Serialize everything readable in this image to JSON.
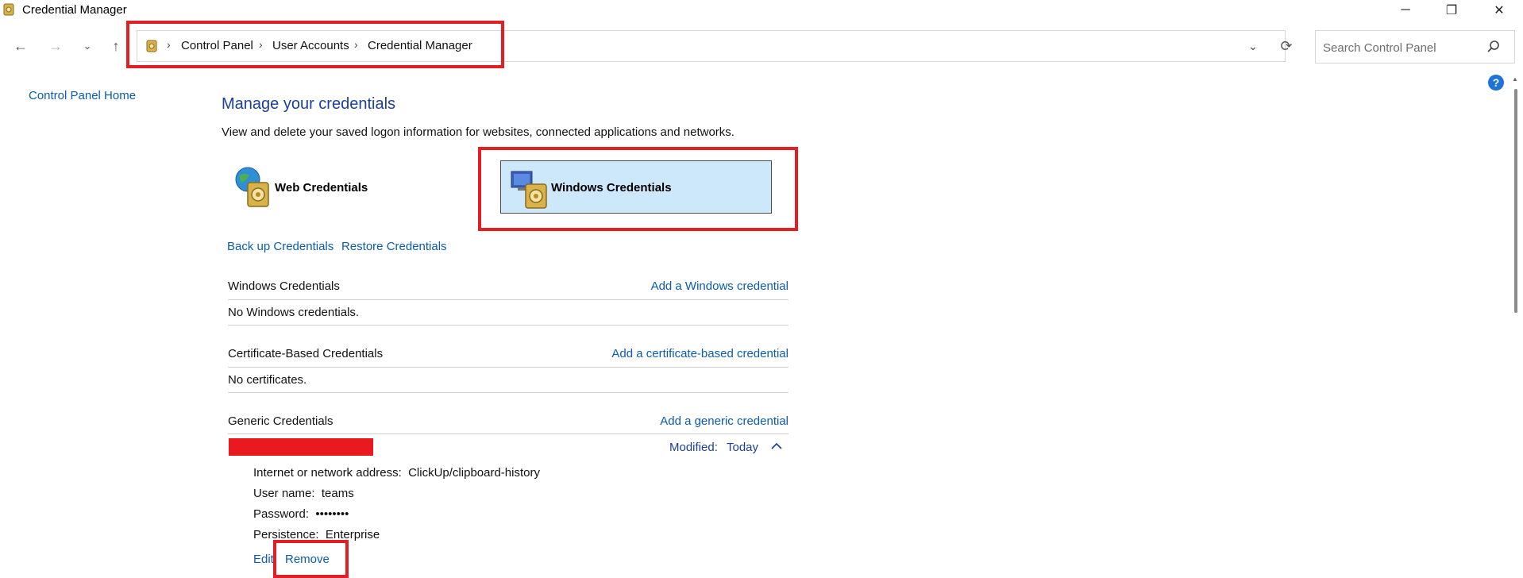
{
  "window": {
    "title": "Credential Manager",
    "minimize_glyph": "─",
    "maximize_glyph": "❐",
    "close_glyph": "✕"
  },
  "nav": {
    "back_glyph": "←",
    "forward_glyph": "→",
    "recent_glyph": "⌄",
    "up_glyph": "↑",
    "refresh_glyph": "⟳",
    "dropdown_glyph": "⌄"
  },
  "breadcrumb": {
    "separator": "›",
    "items": [
      "Control Panel",
      "User Accounts",
      "Credential Manager"
    ]
  },
  "search": {
    "placeholder": "Search Control Panel"
  },
  "help": {
    "glyph": "?"
  },
  "left_nav": {
    "home": "Control Panel Home"
  },
  "main": {
    "title": "Manage your credentials",
    "description": "View and delete your saved logon information for websites, connected applications and networks.",
    "tiles": {
      "web": "Web Credentials",
      "windows": "Windows Credentials"
    },
    "actions": {
      "backup": "Back up Credentials",
      "restore": "Restore Credentials"
    },
    "sections": [
      {
        "title": "Windows Credentials",
        "link": "Add a Windows credential",
        "empty": "No Windows credentials."
      },
      {
        "title": "Certificate-Based Credentials",
        "link": "Add a certificate-based credential",
        "empty": "No certificates."
      },
      {
        "title": "Generic Credentials",
        "link": "Add a generic credential"
      }
    ],
    "credential": {
      "modified_label": "Modified:",
      "modified_value": "Today",
      "details": {
        "address": "Internet or network address:  ClickUp/clipboard-history",
        "username": "User name:  teams",
        "password": "Password:  ••••••••",
        "persistence": "Persistence:  Enterprise"
      },
      "edit": "Edit",
      "remove": "Remove"
    }
  },
  "colors": {
    "link": "#0b5cad",
    "title": "#1a3f9c",
    "highlight": "#e11f25",
    "tile_selected": "#cde8fb"
  }
}
